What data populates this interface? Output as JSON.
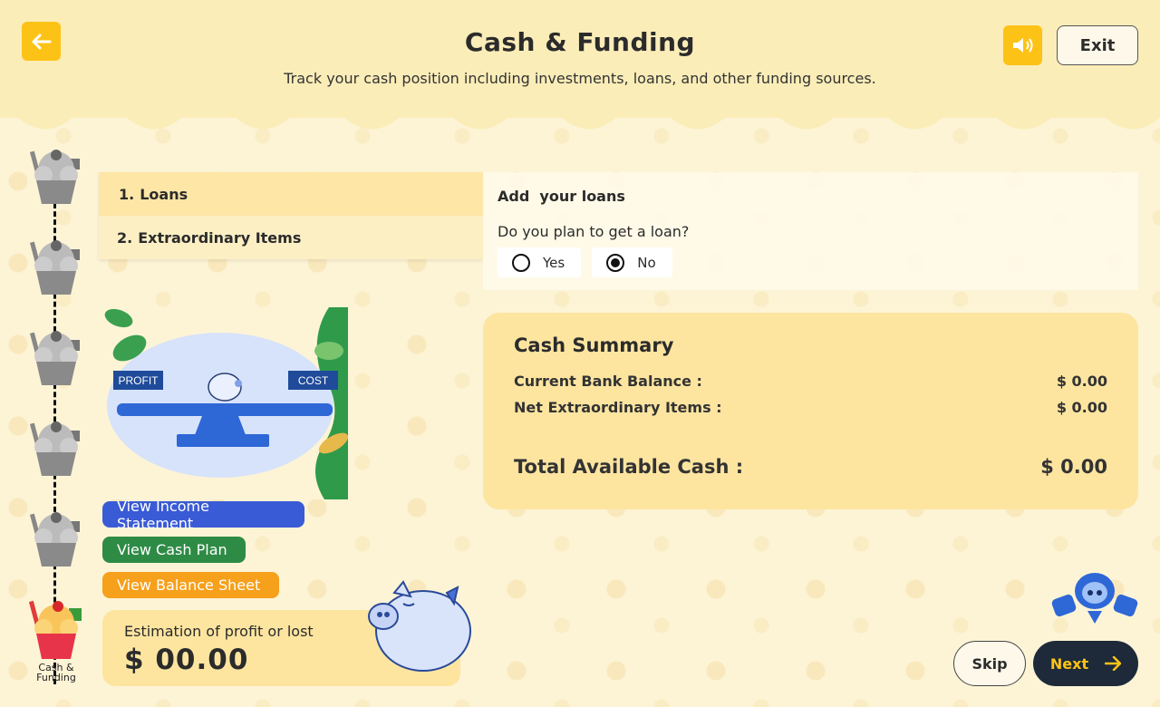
{
  "header": {
    "title": "Cash & Funding",
    "subtitle": "Track your cash position including investments, loans, and other funding sources.",
    "exit_label": "Exit"
  },
  "progress": {
    "current_step_label": "Cash & Funding",
    "steps_total": 6,
    "current_step": 6
  },
  "tabs": [
    {
      "num": "1.",
      "label": "Loans",
      "active": true
    },
    {
      "num": "2.",
      "label": "Extraordinary Items",
      "active": false
    }
  ],
  "loans": {
    "title": "Add  your loans",
    "question": "Do you plan to get a loan?",
    "options": [
      "Yes",
      "No"
    ],
    "selected": "No"
  },
  "illustration": {
    "left_label": "PROFIT",
    "right_label": "COST"
  },
  "summary": {
    "title": "Cash Summary",
    "rows": [
      {
        "label": "Current Bank Balance :",
        "value": "$ 0.00"
      },
      {
        "label": "Net Extraordinary Items :",
        "value": "$ 0.00"
      }
    ],
    "total_label": "Total Available Cash :",
    "total_value": "$ 0.00"
  },
  "actions": {
    "income": "View Income Statement",
    "cash": "View Cash Plan",
    "balance": "View Balance Sheet"
  },
  "estimate": {
    "label": "Estimation of profit or lost",
    "value": "$ 00.00"
  },
  "nav": {
    "skip": "Skip",
    "next": "Next"
  },
  "colors": {
    "accent": "#fcc316",
    "income": "#3a5bd6",
    "cash": "#2e8b45",
    "balance": "#f6a01c",
    "next_bg": "#1e2a3a"
  }
}
